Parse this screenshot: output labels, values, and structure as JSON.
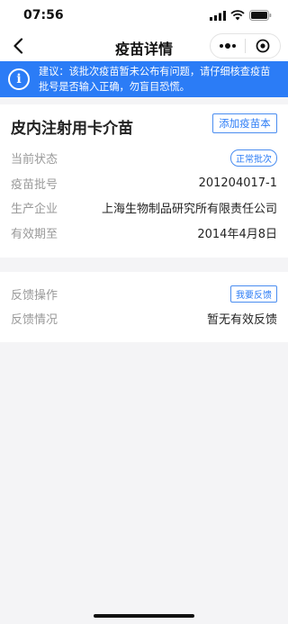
{
  "status_bar": {
    "time": "07:56"
  },
  "navbar": {
    "title": "疫苗详情"
  },
  "banner": {
    "text": "建议：该批次疫苗暂未公布有问题，请仔细核查疫苗批号是否输入正确，勿盲目恐慌。"
  },
  "vaccine": {
    "name": "皮内注射用卡介苗",
    "add_button": "添加疫苗本",
    "fields": [
      {
        "label": "当前状态",
        "value": "正常批次"
      },
      {
        "label": "疫苗批号",
        "value": "201204017-1"
      },
      {
        "label": "生产企业",
        "value": "上海生物制品研究所有限责任公司"
      },
      {
        "label": "有效期至",
        "value": "2014年4月8日"
      }
    ]
  },
  "feedback": {
    "action_label": "反馈操作",
    "action_button": "我要反馈",
    "status_label": "反馈情况",
    "status_value": "暂无有效反馈"
  },
  "colors": {
    "accent": "#2b7cf6",
    "background": "#f4f4f6"
  }
}
